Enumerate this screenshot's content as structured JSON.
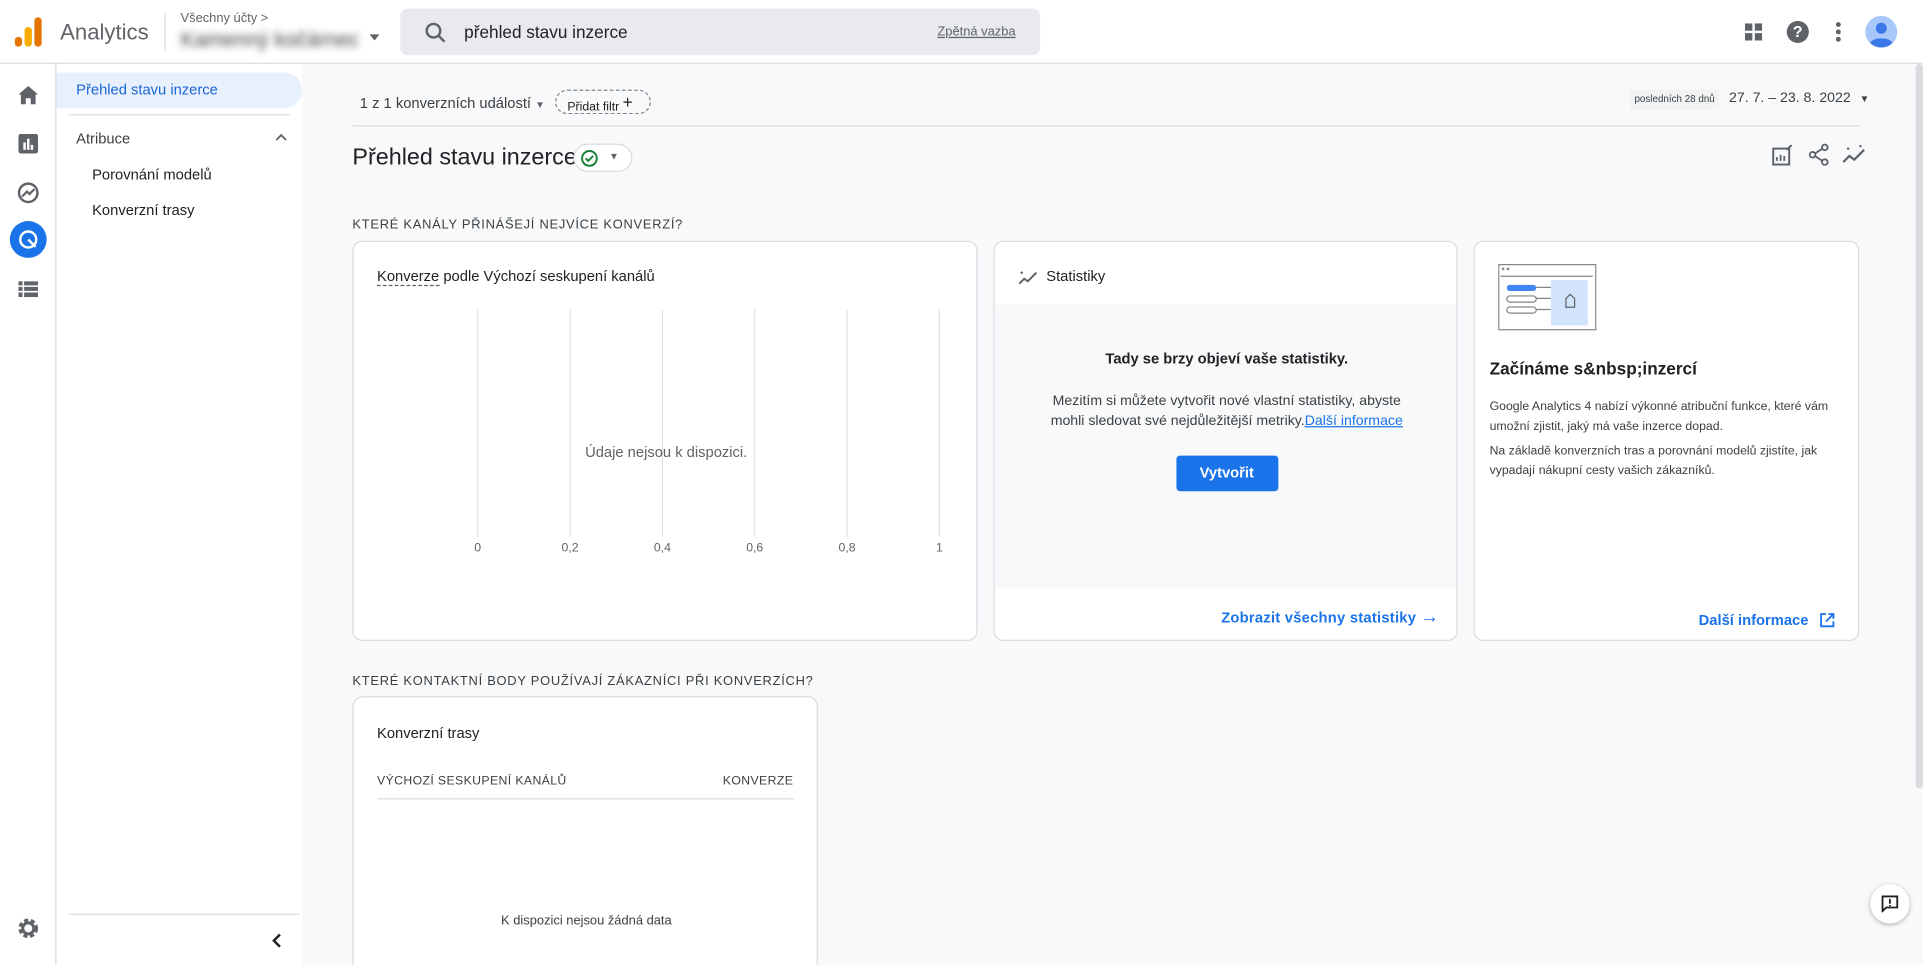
{
  "app": {
    "name": "Analytics",
    "account_path": "Všechny účty >",
    "account_name": "Kamenný kočárnec"
  },
  "search": {
    "value": "přehled stavu inzerce",
    "feedback": "Zpětná vazba"
  },
  "topbar_icons": [
    "apps-icon",
    "help-icon",
    "more-vert-icon",
    "avatar"
  ],
  "rail": [
    "home-icon",
    "reports-icon",
    "explore-icon",
    "advertising-icon",
    "configure-icon",
    "settings-icon"
  ],
  "sidebar": {
    "active": "Přehled stavu inzerce",
    "group": "Atribuce",
    "items": [
      {
        "label": "Porovnání modelů"
      },
      {
        "label": "Konverzní trasy"
      }
    ]
  },
  "filters": {
    "conversions": "1 z 1 konverzních událostí",
    "add_filter": "Přidat filtr",
    "date_preset": "posledních 28 dnů",
    "date_range": "27. 7. – 23. 8. 2022"
  },
  "page": {
    "title": "Přehled stavu inzerce",
    "status_color": "#188038"
  },
  "section1": "KTERÉ KANÁLY PŘINÁŠEJÍ NEJVÍCE KONVERZÍ?",
  "chart_card": {
    "title_metric": "Konverze",
    "title_rest": " podle Výchozí seskupení kanálů",
    "empty": "Údaje nejsou k dispozici."
  },
  "chart_data": {
    "type": "bar",
    "categories": [],
    "values": [],
    "xlim": [
      0,
      1
    ],
    "x_ticks": [
      "0",
      "0,2",
      "0,4",
      "0,6",
      "0,8",
      "1"
    ],
    "grid": true
  },
  "stats_card": {
    "title": "Statistiky",
    "heading": "Tady se brzy objeví vaše statistiky.",
    "body": "Mezitím si můžete vytvořit nové vlastní statistiky, abyste mohli sledovat své nejdůležitější metriky.",
    "body_link": "Další informace",
    "button": "Vytvořit",
    "footer_link": "Zobrazit všechny statistiky"
  },
  "info_card": {
    "title": "Začínáme s&nbsp;inzercí",
    "p1": "Google Analytics 4 nabízí výkonné atribuční funkce, které vám umožní zjistit, jaký má vaše inzerce dopad.",
    "p2": "Na základě konverzních tras a porovnání modelů zjistíte, jak vypadají nákupní cesty vašich zákazníků.",
    "link": "Další informace"
  },
  "section2": "KTERÉ KONTAKTNÍ BODY POUŽÍVAJÍ ZÁKAZNÍCI PŘI KONVERZÍCH?",
  "paths_card": {
    "title": "Konverzní trasy",
    "col1": "VÝCHOZÍ SESKUPENÍ KANÁLŮ",
    "col2": "KONVERZE",
    "empty": "K dispozici nejsou žádná data"
  },
  "colors": {
    "accent": "#1a73e8",
    "active_bg": "#e8f0fe",
    "active_text": "#1967d2"
  }
}
